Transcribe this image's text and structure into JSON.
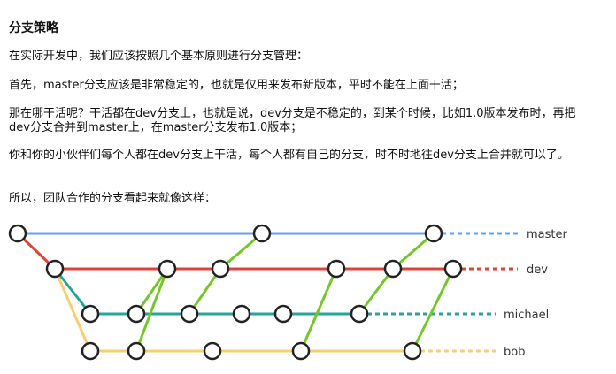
{
  "title": "分支策略",
  "paragraphs": [
    "在实际开发中，我们应该按照几个基本原则进行分支管理：",
    "首先，master分支应该是非常稳定的，也就是仅用来发布新版本，平时不能在上面干活；",
    "那在哪干活呢？干活都在dev分支上，也就是说，dev分支是不稳定的，到某个时候，比如1.0版本发布时，再把dev分支合并到master上，在master分支发布1.0版本；",
    "你和你的小伙伴们每个人都在dev分支上干活，每个人都有自己的分支，时不时地往dev分支上合并就可以了。",
    "所以，团队合作的分支看起来就像这样："
  ],
  "diagram": {
    "branches": [
      {
        "id": "master",
        "label": "master",
        "color": "#6aa1e6"
      },
      {
        "id": "dev",
        "label": "dev",
        "color": "#d9453c"
      },
      {
        "id": "michael",
        "label": "michael",
        "color": "#2aa39b"
      },
      {
        "id": "bob",
        "label": "bob",
        "color": "#f4cf74"
      }
    ],
    "merge_color": "#74c62a",
    "node_fill": "#ffffff",
    "node_stroke": "#222222"
  }
}
